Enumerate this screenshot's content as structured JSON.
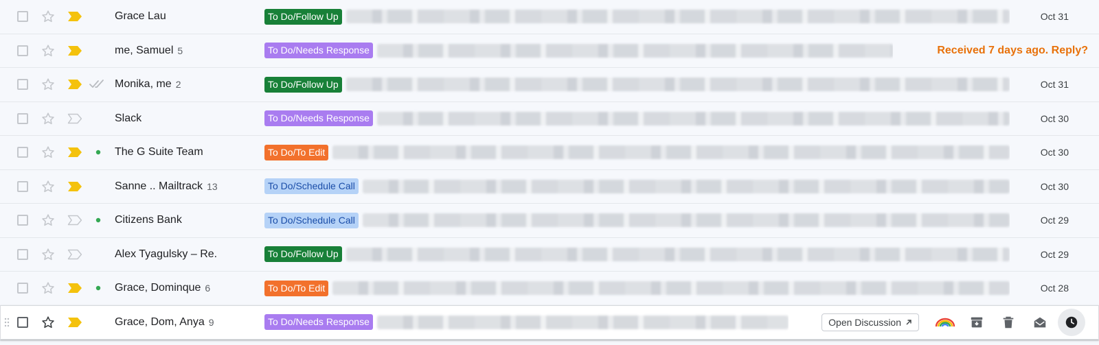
{
  "colors": {
    "follow_up": "#188038",
    "needs_response": "#a97cf0",
    "to_edit": "#f2712c",
    "schedule_call": "#b5d2f7",
    "schedule_call_text": "#1a4da8",
    "important_filled": "#f4c20d",
    "reminder": "#e8710a"
  },
  "rows": [
    {
      "sender": "Grace Lau",
      "count": "",
      "important": true,
      "extra_icon": "",
      "label": "To Do/Follow Up",
      "label_kind": "follow_up",
      "date": "Oct 31"
    },
    {
      "sender": "me, Samuel",
      "count": "5",
      "important": true,
      "extra_icon": "",
      "label": "To Do/Needs Response",
      "label_kind": "needs_response",
      "date": "",
      "reminder": "Received 7 days ago. Reply?"
    },
    {
      "sender": "Monika, me",
      "count": "2",
      "important": true,
      "extra_icon": "double-check-icon",
      "label": "To Do/Follow Up",
      "label_kind": "follow_up",
      "date": "Oct 31"
    },
    {
      "sender": "Slack",
      "count": "",
      "important": false,
      "extra_icon": "",
      "label": "To Do/Needs Response",
      "label_kind": "needs_response",
      "date": "Oct 30"
    },
    {
      "sender": "The G Suite Team",
      "count": "",
      "important": true,
      "extra_icon": "green-dot-icon",
      "label": "To Do/To Edit",
      "label_kind": "to_edit",
      "date": "Oct 30"
    },
    {
      "sender": "Sanne .. Mailtrack",
      "count": "13",
      "important": true,
      "extra_icon": "",
      "label": "To Do/Schedule Call",
      "label_kind": "schedule_call",
      "date": "Oct 30"
    },
    {
      "sender": "Citizens Bank",
      "count": "",
      "important": false,
      "extra_icon": "green-dot-icon",
      "label": "To Do/Schedule Call",
      "label_kind": "schedule_call",
      "date": "Oct 29"
    },
    {
      "sender": "Alex Tyagulsky – Re.",
      "count": "",
      "important": false,
      "extra_icon": "",
      "label": "To Do/Follow Up",
      "label_kind": "follow_up",
      "date": "Oct 29"
    },
    {
      "sender": "Grace, Dominque",
      "count": "6",
      "important": true,
      "extra_icon": "green-dot-icon",
      "label": "To Do/To Edit",
      "label_kind": "to_edit",
      "date": "Oct 28"
    },
    {
      "sender": "Grace, Dom, Anya",
      "count": "9",
      "important": true,
      "extra_icon": "",
      "label": "To Do/Needs Response",
      "label_kind": "needs_response",
      "date": "",
      "hover": true,
      "actions": {
        "open_discussion": "Open Discussion",
        "icons": [
          "rainbow-icon",
          "archive-icon",
          "delete-icon",
          "mark-unread-icon",
          "snooze-icon"
        ]
      }
    }
  ]
}
